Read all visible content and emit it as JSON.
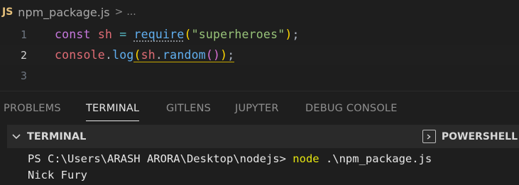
{
  "breadcrumb": {
    "file_icon": "JS",
    "file_name": "npm_package.js",
    "separator": ">",
    "more": "..."
  },
  "editor": {
    "lines": [
      {
        "number": "1",
        "tokens": [
          "const",
          "sh",
          "=",
          "require",
          "(",
          "\"superheroes\"",
          ")",
          ";"
        ]
      },
      {
        "number": "2",
        "tokens": [
          "console",
          ".",
          "log",
          "(",
          "sh",
          ".",
          "random",
          "(",
          ")",
          ")",
          ";"
        ]
      },
      {
        "number": "3",
        "tokens": []
      }
    ],
    "active_line": 2
  },
  "panel": {
    "tabs": [
      "PROBLEMS",
      "TERMINAL",
      "GITLENS",
      "JUPYTER",
      "DEBUG CONSOLE"
    ],
    "active_tab": "TERMINAL"
  },
  "terminal": {
    "title": "TERMINAL",
    "shell_label": "POWERSHELL",
    "prompt": "PS C:\\Users\\ARASH ARORA\\Desktop\\nodejs> ",
    "command": "node",
    "args": " .\\npm_package.js",
    "output": "Nick Fury"
  },
  "colors": {
    "background": "#1e1e1e",
    "keyword": "#c678dd",
    "variable": "#e06c75",
    "function": "#61afef",
    "string": "#98c379",
    "command": "#e5e510"
  }
}
